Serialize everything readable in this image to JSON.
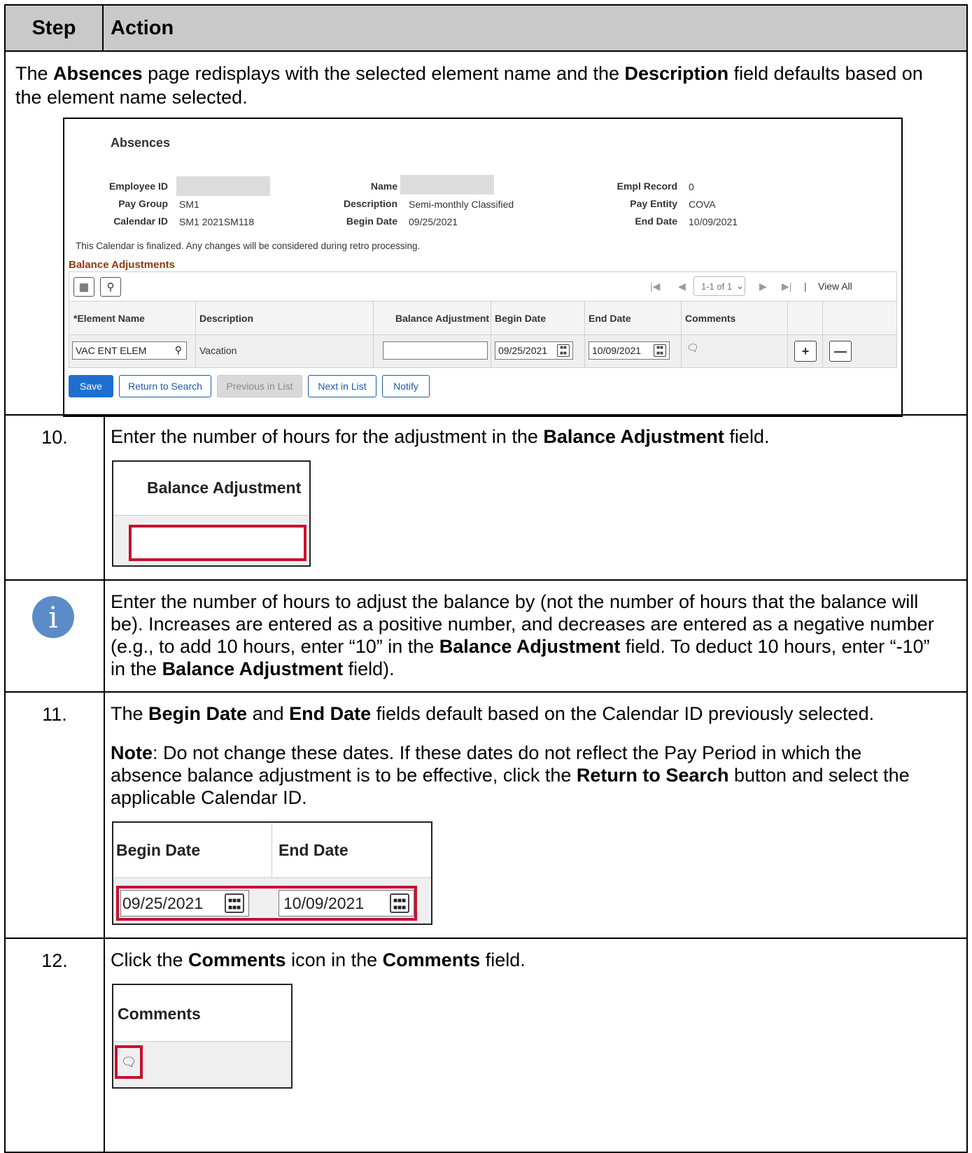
{
  "table_header": {
    "step": "Step",
    "action": "Action"
  },
  "intro": {
    "p1": "The ",
    "b1": "Absences",
    "p2": " page redisplays with the selected element name and the ",
    "b2": "Description",
    "p3": " field defaults based on the element name selected."
  },
  "absences": {
    "title": "Absences",
    "employee_id_label": "Employee ID",
    "pay_group_label": "Pay Group",
    "pay_group": "SM1",
    "calendar_id_label": "Calendar ID",
    "calendar_id": "SM1 2021SM118",
    "name_label": "Name",
    "description_label": "Description",
    "description": "Semi-monthly Classified",
    "begin_date_label": "Begin Date",
    "begin_date": "09/25/2021",
    "empl_record_label": "Empl Record",
    "empl_record": "0",
    "pay_entity_label": "Pay Entity",
    "pay_entity": "COVA",
    "end_date_label": "End Date",
    "end_date": "10/09/2021",
    "finalized_note": "This Calendar is finalized. Any changes will be considered during retro processing.",
    "balance_adjustments_title": "Balance Adjustments",
    "pager": {
      "range": "1-1 of 1",
      "view_all": "View All"
    },
    "columns": {
      "element_name": "*Element Name",
      "description": "Description",
      "balance_adjustment": "Balance Adjustment",
      "begin_date": "Begin Date",
      "end_date": "End Date",
      "comments": "Comments"
    },
    "row": {
      "element_name": "VAC ENT ELEM",
      "description": "Vacation",
      "balance_adjustment": "",
      "begin_date": "09/25/2021",
      "end_date": "10/09/2021"
    },
    "buttons": {
      "save": "Save",
      "return_to_search": "Return to Search",
      "previous_in_list": "Previous in List",
      "next_in_list": "Next in List",
      "notify": "Notify"
    }
  },
  "step10": {
    "num": "10.",
    "p1": "Enter the number of hours for the adjustment in the ",
    "b1": "Balance Adjustment",
    "p2": " field.",
    "crop_header": "Balance Adjustment"
  },
  "info": {
    "p1": "Enter the number of hours to adjust the balance by (not the number of hours that the balance will be). Increases are entered as a positive number, and decreases are entered as a negative number (e.g., to add 10 hours, enter “10” in the ",
    "b1": "Balance Adjustment",
    "p2": " field. To deduct 10 hours, enter “-10” in the ",
    "b2": "Balance Adjustment",
    "p3": " field)."
  },
  "step11": {
    "num": "11.",
    "p1": "The ",
    "b1": "Begin Date",
    "p2": " and ",
    "b2": "End Date",
    "p3": " fields default based on the Calendar ID previously selected.",
    "note_b": "Note",
    "note_p1": ": Do not change these dates. If these dates do not reflect the Pay Period in which the absence balance adjustment is to be effective, click the ",
    "note_b2": "Return to Search",
    "note_p2": " button and select the applicable Calendar ID.",
    "crop_begin_header": "Begin Date",
    "crop_end_header": "End Date",
    "crop_begin_value": "09/25/2021",
    "crop_end_value": "10/09/2021"
  },
  "step12": {
    "num": "12.",
    "p1": "Click the ",
    "b1": "Comments",
    "p2": " icon in the ",
    "b2": "Comments",
    "p3": " field.",
    "crop_header": "Comments"
  },
  "colors": {
    "header_bg": "#c9c9c9",
    "highlight": "#c8102e",
    "primary_button": "#1e6fd0",
    "section_title": "#8b3a0e"
  }
}
